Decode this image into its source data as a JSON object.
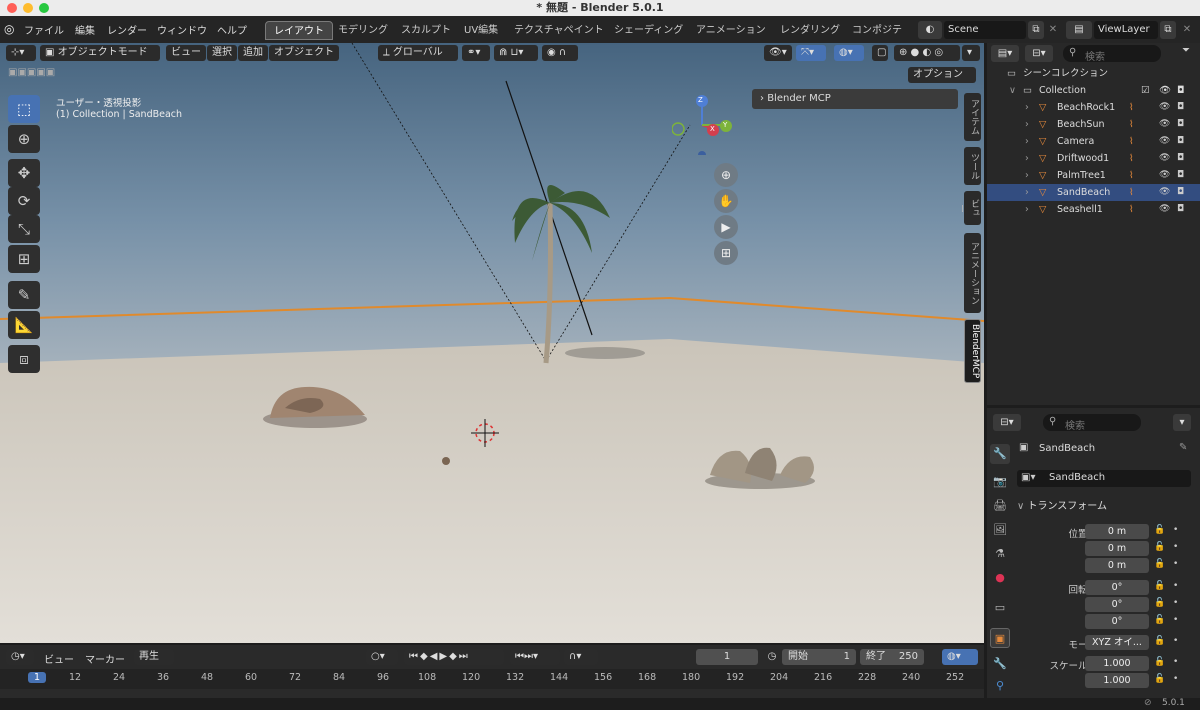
{
  "window": {
    "title": "* 無題 - Blender 5.0.1"
  },
  "menus": [
    "ファイル",
    "編集",
    "レンダー",
    "ウィンドウ",
    "ヘルプ"
  ],
  "workspaces": [
    "レイアウト",
    "モデリング",
    "スカルプト",
    "UV編集",
    "テクスチャペイント",
    "シェーディング",
    "アニメーション",
    "レンダリング",
    "コンポジテ"
  ],
  "scene": {
    "label": "Scene",
    "view_layer": "ViewLayer"
  },
  "viewport": {
    "mode": "オブジェクトモード",
    "menus": [
      "ビュー",
      "選択",
      "追加",
      "オブジェクト"
    ],
    "orientation": "グローバル",
    "options": "オプション",
    "view_label": "ユーザー・透視投影",
    "context": "(1) Collection | SandBeach",
    "mcp_panel": "Blender MCP",
    "side_tabs": [
      "アイテム",
      "ツール",
      "ビュー",
      "アニメーション",
      "BlenderMCP"
    ],
    "gizmo": {
      "z": "Z",
      "x": "X",
      "y": "Y"
    }
  },
  "timeline": {
    "menus": [
      "ビュー",
      "マーカー"
    ],
    "playback": "再生",
    "current_frame": "1",
    "start_label": "開始",
    "start": "1",
    "end_label": "終了",
    "end": "250",
    "ticks": [
      "1",
      "12",
      "24",
      "36",
      "48",
      "60",
      "72",
      "84",
      "96",
      "108",
      "120",
      "132",
      "144",
      "156",
      "168",
      "180",
      "192",
      "204",
      "216",
      "228",
      "240",
      "252"
    ]
  },
  "outliner": {
    "search_placeholder": "検索",
    "root": "シーンコレクション",
    "collection": "Collection",
    "items": [
      {
        "name": "BeachRock1",
        "selected": false
      },
      {
        "name": "BeachSun",
        "selected": false
      },
      {
        "name": "Camera",
        "selected": false
      },
      {
        "name": "Driftwood1",
        "selected": false
      },
      {
        "name": "PalmTree1",
        "selected": false
      },
      {
        "name": "SandBeach",
        "selected": true
      },
      {
        "name": "Seashell1",
        "selected": false
      }
    ]
  },
  "properties": {
    "search_placeholder": "検索",
    "object_name": "SandBeach",
    "data_name": "SandBeach",
    "section": "トランスフォーム",
    "rows": [
      {
        "label": "位置 X",
        "value": "0 m"
      },
      {
        "label": "Y",
        "value": "0 m"
      },
      {
        "label": "Z",
        "value": "0 m"
      },
      {
        "label": "回転 X",
        "value": "0°"
      },
      {
        "label": "Y",
        "value": "0°"
      },
      {
        "label": "Z",
        "value": "0°"
      },
      {
        "label": "モード",
        "value": "XYZ オイ..."
      },
      {
        "label": "スケール X",
        "value": "1.000"
      },
      {
        "label": "Y",
        "value": "1.000"
      }
    ]
  },
  "status": {
    "version": "5.0.1"
  },
  "colors": {
    "accent": "#4772b3",
    "selected_row": "#334d80",
    "orange": "#e4893b"
  }
}
